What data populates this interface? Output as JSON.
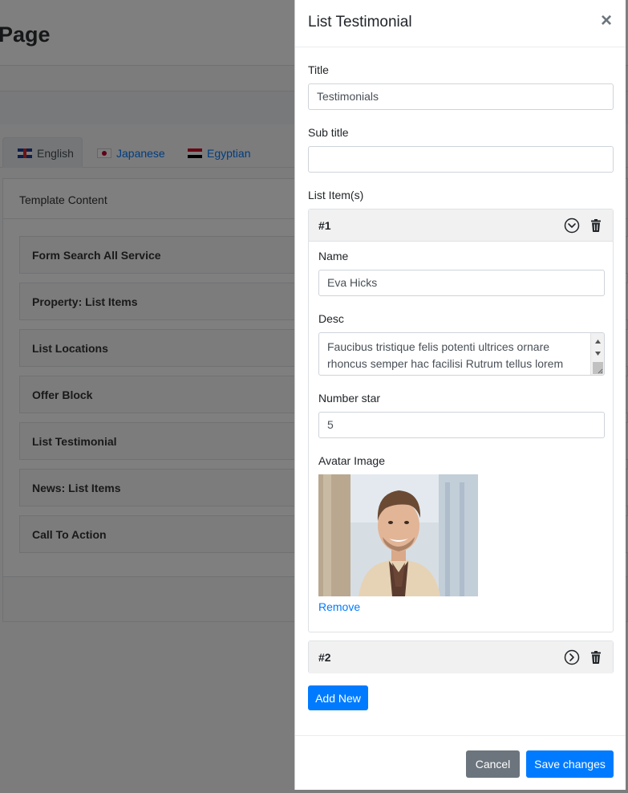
{
  "background": {
    "page_heading": "Page",
    "tabs": [
      {
        "label": "English",
        "flag": "uk-flag-icon",
        "active": true
      },
      {
        "label": "Japanese",
        "flag": "japan-flag-icon",
        "active": false
      },
      {
        "label": "Egyptian",
        "flag": "egypt-flag-icon",
        "active": false
      }
    ],
    "template_content_label": "Template Content",
    "blocks": [
      "Form Search All Service",
      "Property: List Items",
      "List Locations",
      "Offer Block",
      "List Testimonial",
      "News: List Items",
      "Call To Action"
    ]
  },
  "modal": {
    "title": "List Testimonial",
    "close_icon": "×",
    "title_label": "Title",
    "title_value": "Testimonials",
    "subtitle_label": "Sub title",
    "subtitle_value": "",
    "list_items_label": "List Item(s)",
    "items": [
      {
        "number": "#1",
        "expanded": true,
        "name_label": "Name",
        "name_value": "Eva Hicks",
        "desc_label": "Desc",
        "desc_value": "Faucibus tristique felis potenti ultrices ornare rhoncus semper hac facilisi Rutrum tellus lorem",
        "star_label": "Number star",
        "star_value": "5",
        "avatar_label": "Avatar Image",
        "remove_label": "Remove"
      },
      {
        "number": "#2",
        "expanded": false
      }
    ],
    "add_new_label": "Add New",
    "cancel_label": "Cancel",
    "save_label": "Save changes"
  },
  "colors": {
    "primary": "#007bff",
    "secondary": "#6c757d",
    "overlay": "rgba(0,0,0,0.5)"
  }
}
